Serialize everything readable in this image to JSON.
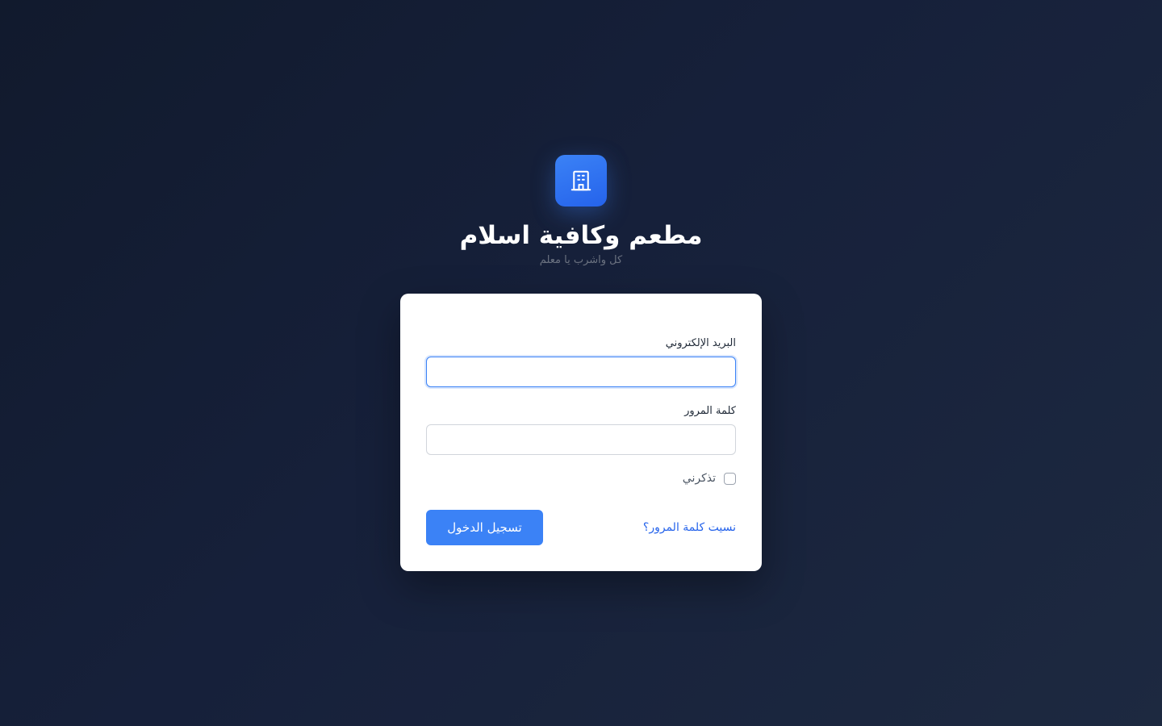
{
  "brand": {
    "icon": "building-icon",
    "title": "مطعم وكافية اسلام",
    "subtitle": "كل واشرب يا معلم"
  },
  "form": {
    "email_label": "البريد الإلكتروني",
    "email_value": "",
    "password_label": "كلمة المرور",
    "password_value": "",
    "remember_label": "تذكرني",
    "remember_checked": false,
    "forgot_label": "نسيت كلمة المرور؟",
    "submit_label": "تسجيل الدخول"
  },
  "colors": {
    "accent": "#3b82f6",
    "background": "#111a2d",
    "link": "#2563eb"
  }
}
